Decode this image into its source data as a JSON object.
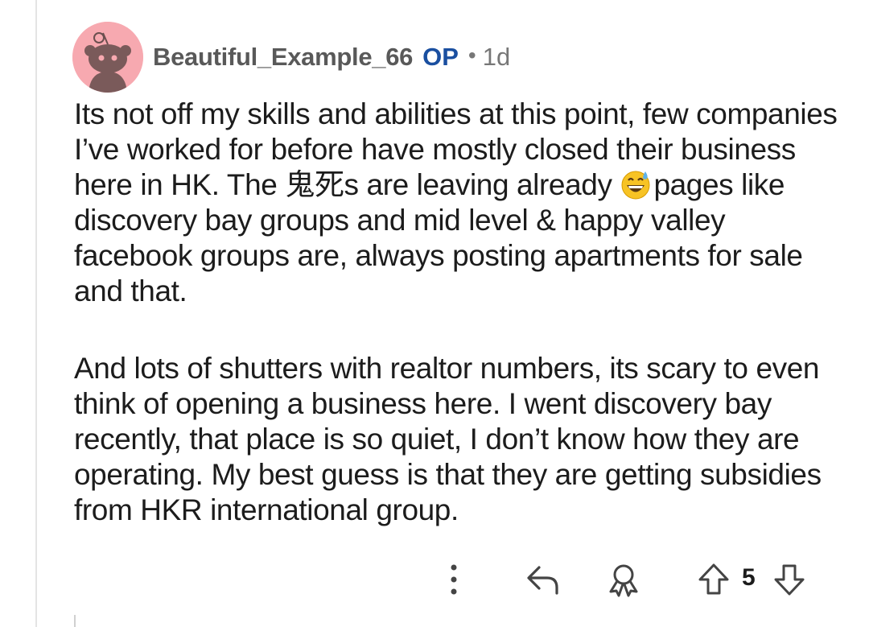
{
  "comment": {
    "username": "Beautiful_Example_66",
    "op_badge": "OP",
    "separator": "•",
    "time": "1d",
    "paragraph1_part1": "Its not off my skills and abilities at this point, few companies I’ve worked for before have mostly closed their business here in HK. The 鬼死s are leaving already ",
    "paragraph1_part2": "pages like discovery bay groups and mid level & happy valley facebook groups are, always posting apartments for sale and that.",
    "paragraph2": "And lots of shutters with realtor numbers, its scary to even think of opening a business here. I went discovery bay recently, that place is so quiet, I don’t know how they are operating. My best guess is that they are getting subsidies from HKR international group."
  },
  "actions": {
    "more_icon": "more-vertical-icon",
    "reply_icon": "reply-icon",
    "award_icon": "award-icon",
    "upvote_icon": "upvote-arrow-icon",
    "vote_count": "5",
    "downvote_icon": "downvote-arrow-icon"
  },
  "colors": {
    "avatar_bg": "#f7a9b0",
    "op_badge": "#1a4fa0",
    "text": "#1c1c1c",
    "meta": "#777777"
  }
}
